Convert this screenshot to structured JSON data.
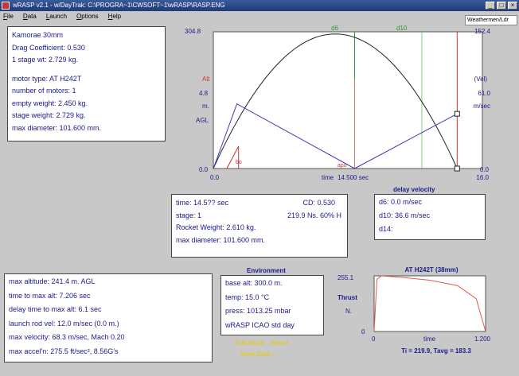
{
  "window": {
    "title": "wRASP v2.1 - w/DayTrak: C:\\PROGRA~1\\CWSOFT~1\\wRASP\\RASP.ENG",
    "tooltip": "Weathermen/Ldr"
  },
  "menu": [
    "File",
    "Data",
    "Launch",
    "Options",
    "Help"
  ],
  "rocket_panel": {
    "name": "Kamorae 30mm",
    "drag": "Drag Coefficient: 0.530",
    "stage": "1 stage   wt: 2.729 kg.",
    "motor": "motor type: AT  H242T",
    "motors": "number of motors: 1",
    "empty": "empty weight: 2.450 kg.",
    "stage_weight": "stage weight: 2.729 kg.",
    "diameter": "max diameter: 101.600 mm."
  },
  "main_plot": {
    "y_top_left": "304.8",
    "y_top_right": "152.4",
    "y_mid_left": "4.8",
    "y_mid_right": "61.0",
    "alt_label": "Alt",
    "alt_unit": "m.",
    "agl": "AGL",
    "vel_label": "(Vel)",
    "vel_unit": "m/sec",
    "y_zero_left": "0.0",
    "y_zero_right": "0.0",
    "x_zero": "0.0",
    "x_max": "16.0",
    "time_label": "time",
    "time_value": "14.500 sec",
    "d6": "d6",
    "d10": "d10",
    "bo": "bo",
    "apo": "apo",
    "chart_data": {
      "type": "line",
      "xlabel": "time",
      "xlim": [
        0,
        16
      ],
      "series": [
        {
          "axis": "left",
          "x": [
            0,
            2,
            4,
            6,
            8.4,
            10,
            12,
            14,
            14.5
          ],
          "y": [
            0,
            90,
            175,
            252,
            300,
            283,
            200,
            50,
            0
          ]
        },
        {
          "axis": "right",
          "x": [
            0,
            1.4,
            8.4,
            14.5
          ],
          "y": [
            0,
            72,
            0,
            61
          ]
        }
      ]
    }
  },
  "flight_panel": {
    "time": "time: 14.5?? sec",
    "cd": "CD: 0.530",
    "stage": "stage: 1",
    "impulse": "219.9 Ns. 60% H",
    "rocket_weight": "Rocket Weight: 2.610 kg.",
    "diameter": "max diameter: 101.600 mm."
  },
  "delay_panel": {
    "title": "delay velocity",
    "d6": "d6: 0.0 m/sec",
    "d10": "d10: 36.6 m/sec",
    "d14": "d14:"
  },
  "results_panel": {
    "alt": "max altitude: 241.4 m. AGL",
    "time_to_max": "time to max alt: 7.206 sec",
    "delay_time": "delay time to max alt: 6.1 sec",
    "rod_vel": "launch rod vel: 12.0 m/sec (0.0  m.)",
    "max_vel": "max velocity: 68.3 m/sec, Mach 0.20",
    "max_accel": "max accel'n: 275.5 ft/sec², 8.56G's"
  },
  "env_panel": {
    "title": "Environment",
    "base_alt": "base alt: 300.0 m.",
    "temp": "temp: 15.0 °C",
    "press": "press: 1013.25 mbar",
    "std": "wRASP ICAO std day",
    "edit_motor": "Edit Motor - Select",
    "more_data": "More Data >"
  },
  "thrust_plot": {
    "title": "AT  H242T (38mm)",
    "y_max": "255.1",
    "y_label": "Thrust",
    "y_unit": "N.",
    "y_zero": "0",
    "x_zero": "0",
    "x_max": "1.200",
    "x_label": "time",
    "summary": "Ti = 219.9, Tavg = 183.3",
    "chart_data": {
      "type": "line",
      "xlabel": "time",
      "ylabel": "Thrust",
      "xlim": [
        0,
        1.2
      ],
      "ylim": [
        0,
        255.1
      ],
      "x": [
        0,
        0.03,
        0.08,
        0.3,
        0.6,
        0.9,
        1.1,
        1.2
      ],
      "y": [
        0,
        240,
        255,
        248,
        235,
        210,
        150,
        0
      ]
    }
  }
}
